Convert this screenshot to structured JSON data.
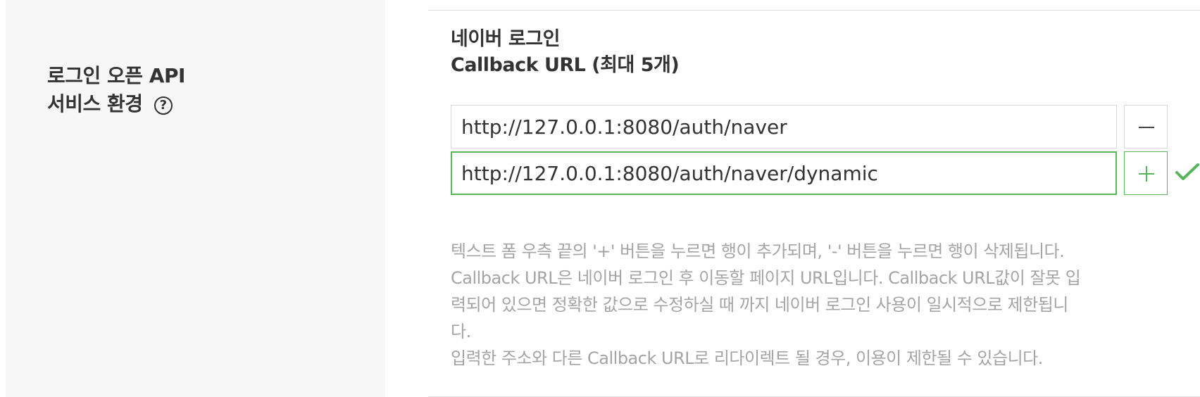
{
  "section": {
    "label_line1": "로그인 오픈 API",
    "label_line2": "서비스 환경",
    "help_icon": "?"
  },
  "callback": {
    "title_line1": "네이버 로그인",
    "title_line2": "Callback URL (최대 5개)",
    "urls": [
      {
        "value": "http://127.0.0.1:8080/auth/naver",
        "button": "remove",
        "button_icon": "minus-icon"
      },
      {
        "value": "http://127.0.0.1:8080/auth/naver/dynamic",
        "button": "add",
        "button_icon": "plus-icon",
        "focused": true,
        "valid": true
      }
    ],
    "help_lines": [
      "텍스트 폼 우측 끝의 '+' 버튼을 누르면 행이 추가되며, '-' 버튼을 누르면 행이 삭제됩니다.",
      "Callback URL은 네이버 로그인 후 이동할 페이지 URL입니다. Callback URL값이 잘못 입",
      "력되어 있으면 정확한 값으로 수정하실 때 까지 네이버 로그인 사용이 일시적으로 제한됩니",
      "다.",
      "입력한 주소와 다른 Callback URL로 리다이렉트 될 경우, 이용이 제한될 수 있습니다."
    ]
  },
  "colors": {
    "accent_green": "#57b55c",
    "label_bg": "#f7f7f7",
    "text_dark": "#333333",
    "text_muted": "#a4a4a4",
    "border": "#d6d6d6"
  }
}
